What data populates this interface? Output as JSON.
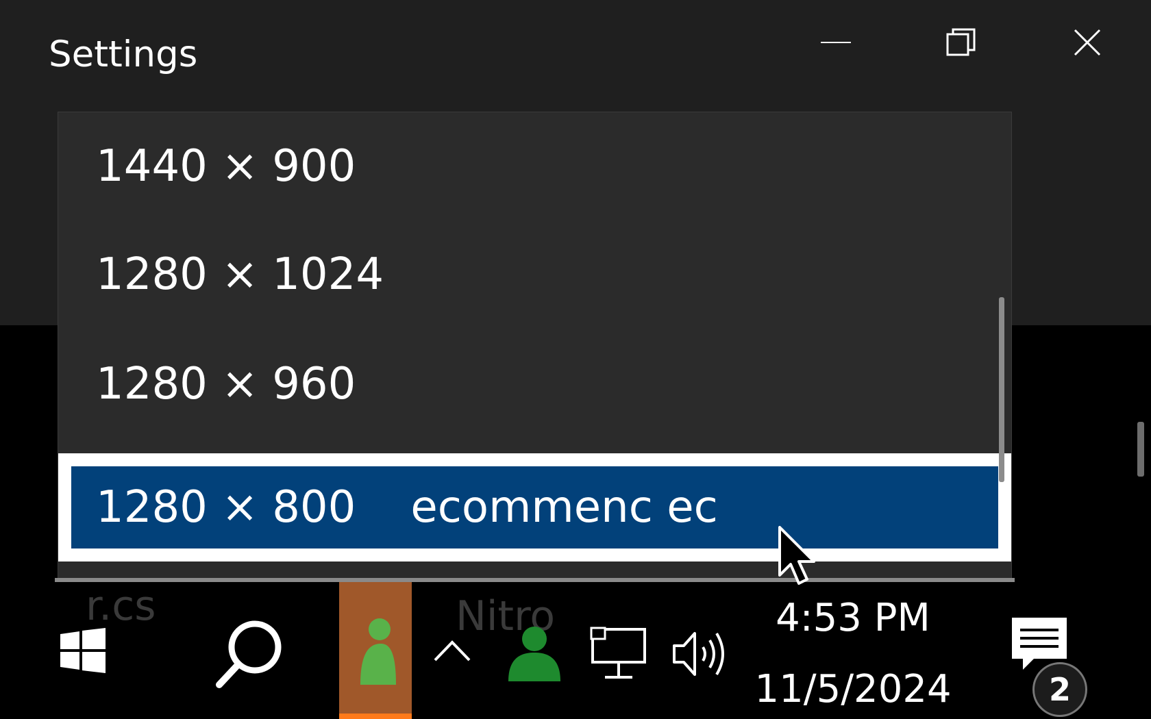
{
  "window": {
    "title": "Settings",
    "buttons": {
      "minimize": "minimize-icon",
      "restore": "restore-icon",
      "close": "close-icon"
    }
  },
  "resolution_dropdown": {
    "options": [
      {
        "label": "1440 × 900"
      },
      {
        "label": "1280 × 1024"
      },
      {
        "label": "1280 × 960"
      },
      {
        "label": "1280 × 800",
        "note": "ecommenc ec",
        "selected": true
      }
    ],
    "colors": {
      "list_bg": "#2b2b2b",
      "selected_bg": "#02417a",
      "selected_border": "#ffffff"
    }
  },
  "taskbar": {
    "ghost_texts": [
      "r.cs",
      "Nitro"
    ],
    "clock": {
      "time": "4:53 PM",
      "date": "11/5/2024"
    },
    "notification_count": "2",
    "colors": {
      "background": "#000000",
      "pinned_app_bg": "#a0582a",
      "pinned_app_accent": "#ff7a1a",
      "people_green": "#1e8a2e"
    },
    "icons": [
      "windows-start-icon",
      "search-icon",
      "pinned-app-icon",
      "chevron-up-icon",
      "people-icon",
      "network-icon",
      "volume-icon",
      "action-center-icon"
    ]
  }
}
